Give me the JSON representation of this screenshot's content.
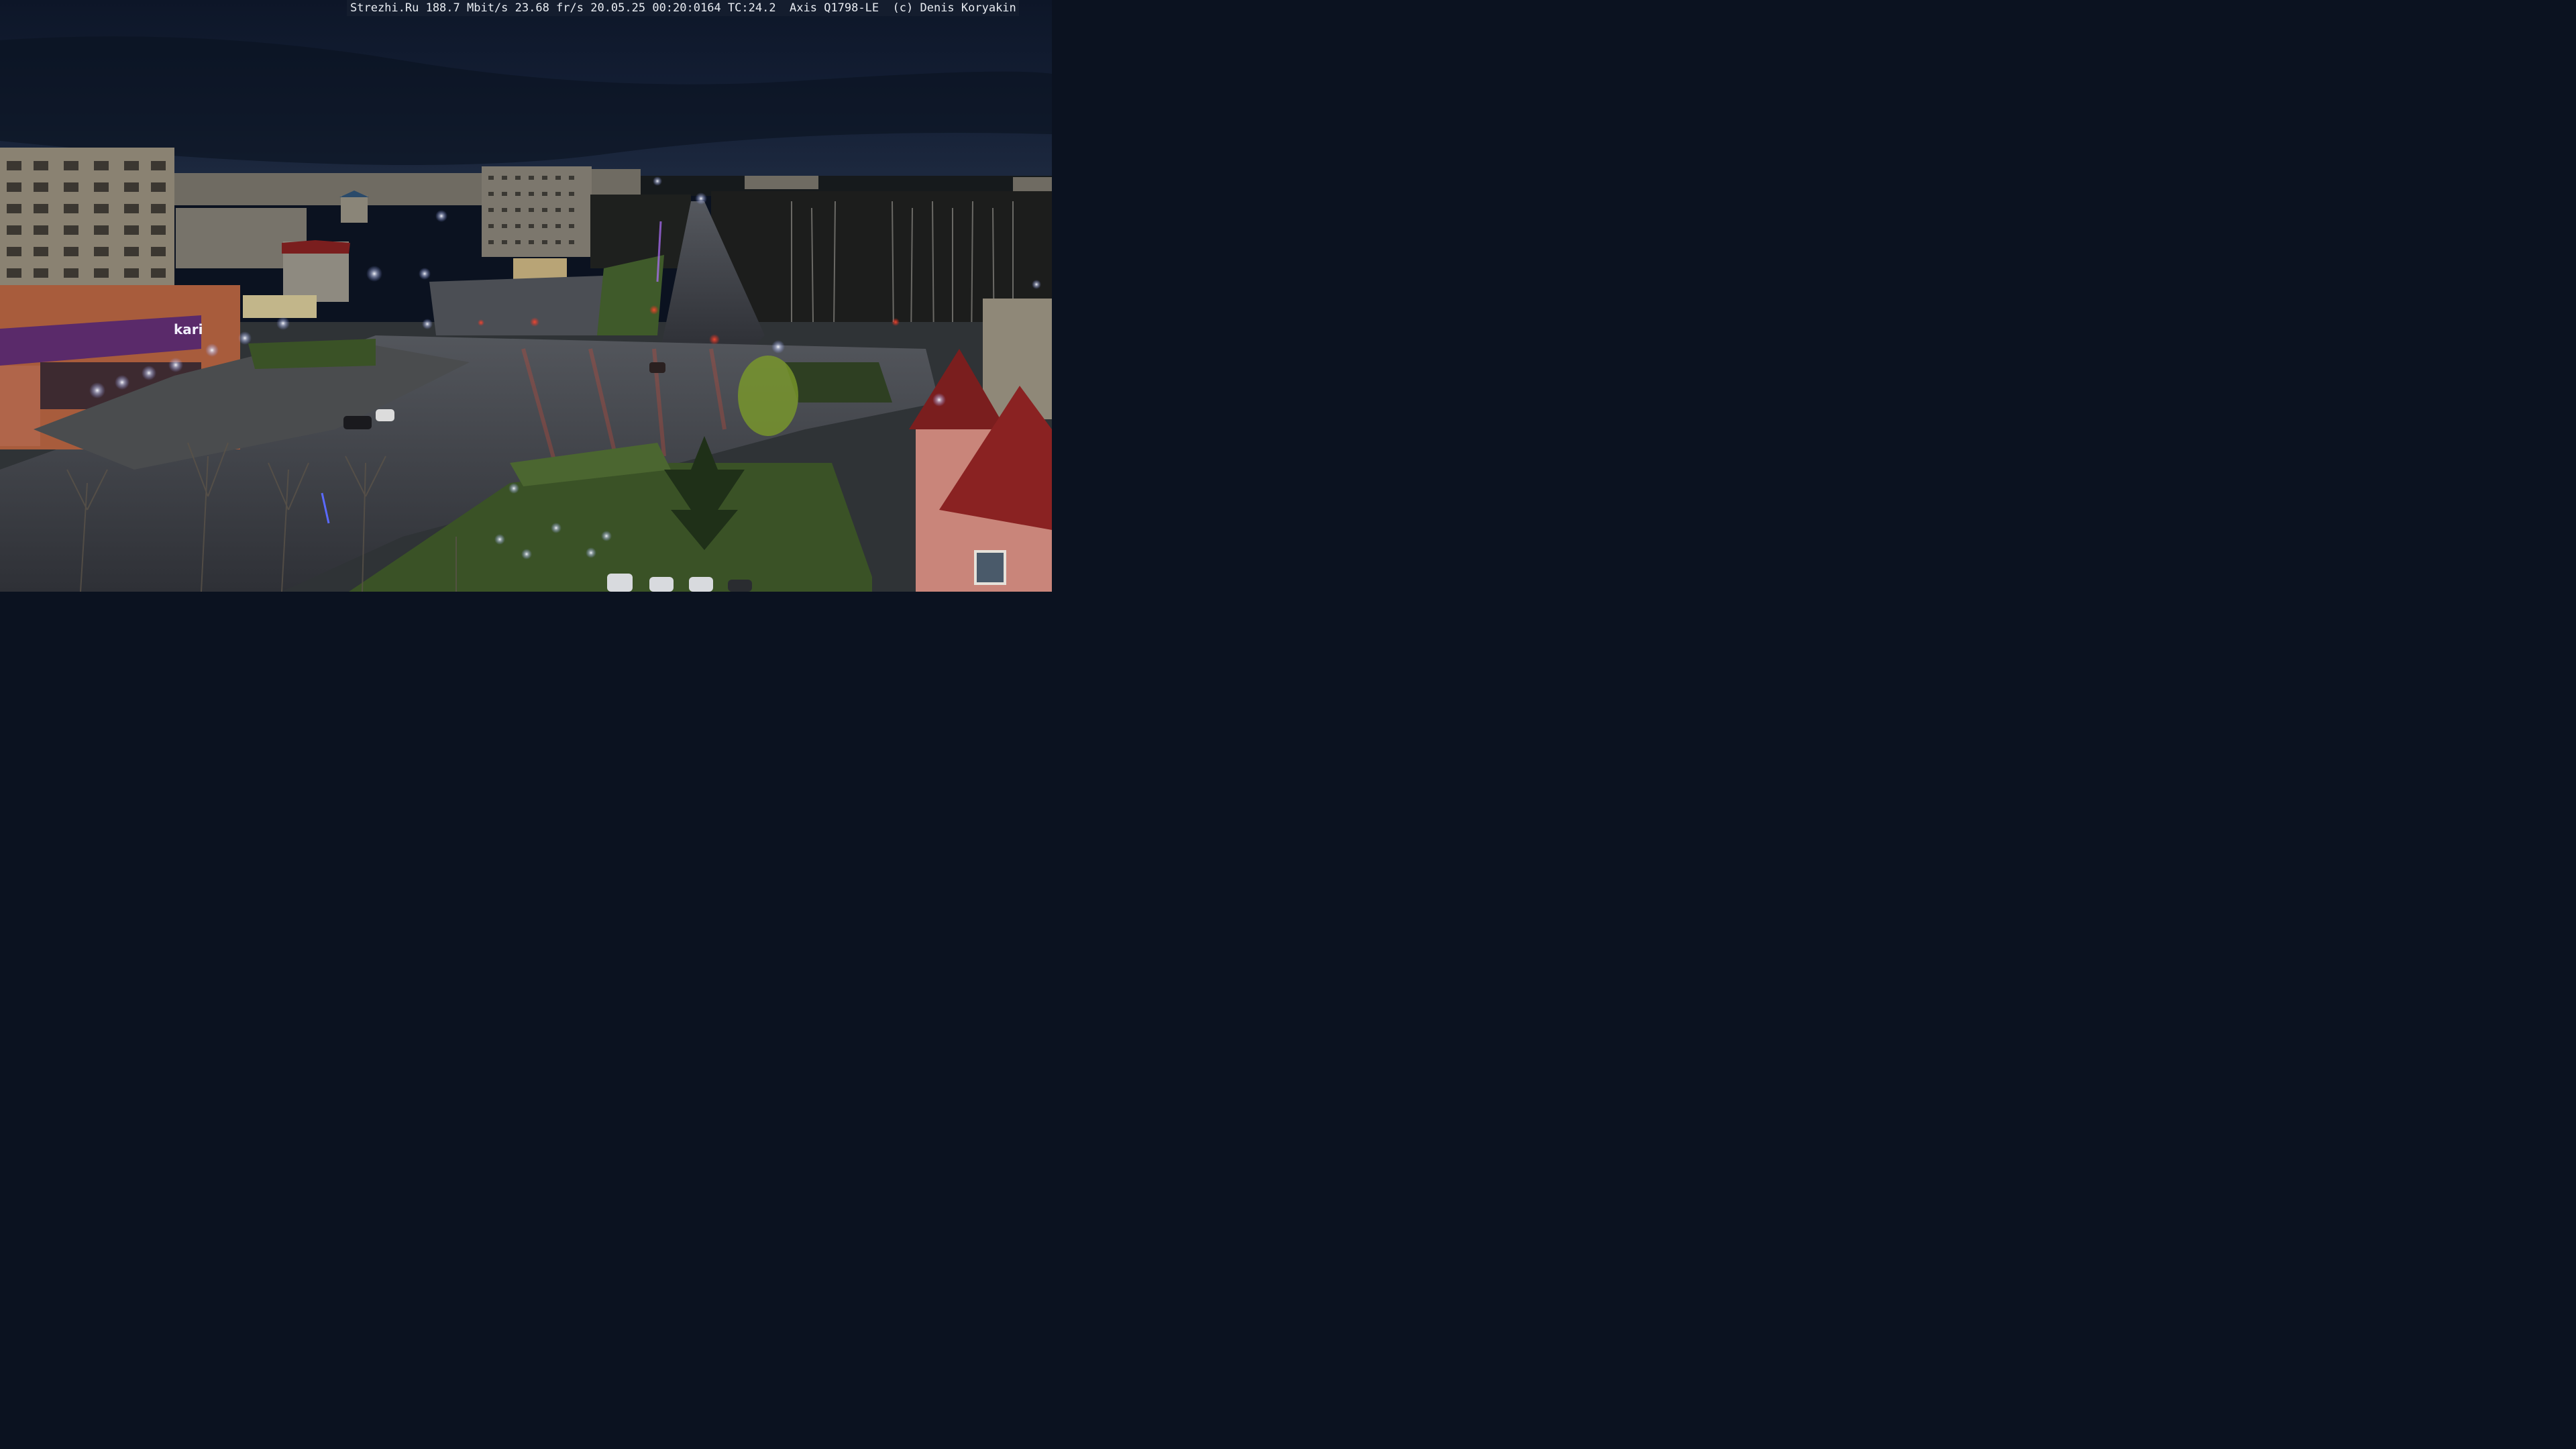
{
  "camera": {
    "osd_text": "Strezhi.Ru 188.7 Mbit/s 23.68 fr/s 20.05.25 00:20:0164 TC:24.2  Axis Q1798-LE  (c) Denis Koryakin"
  },
  "scene": {
    "store_sign": "kari",
    "colors": {
      "sky_top": "#0f1a2e",
      "sky_horizon": "#1d2c44",
      "road": "#3a3d44",
      "grass": "#3f5a2a",
      "building_concrete": "#8a8272",
      "mall_facade": "#a85c3c",
      "mall_band": "#5a2a6a",
      "red_roof": "#7a1e1e",
      "street_light": "#e8ecff",
      "traffic_red": "#ff2a1a"
    }
  }
}
